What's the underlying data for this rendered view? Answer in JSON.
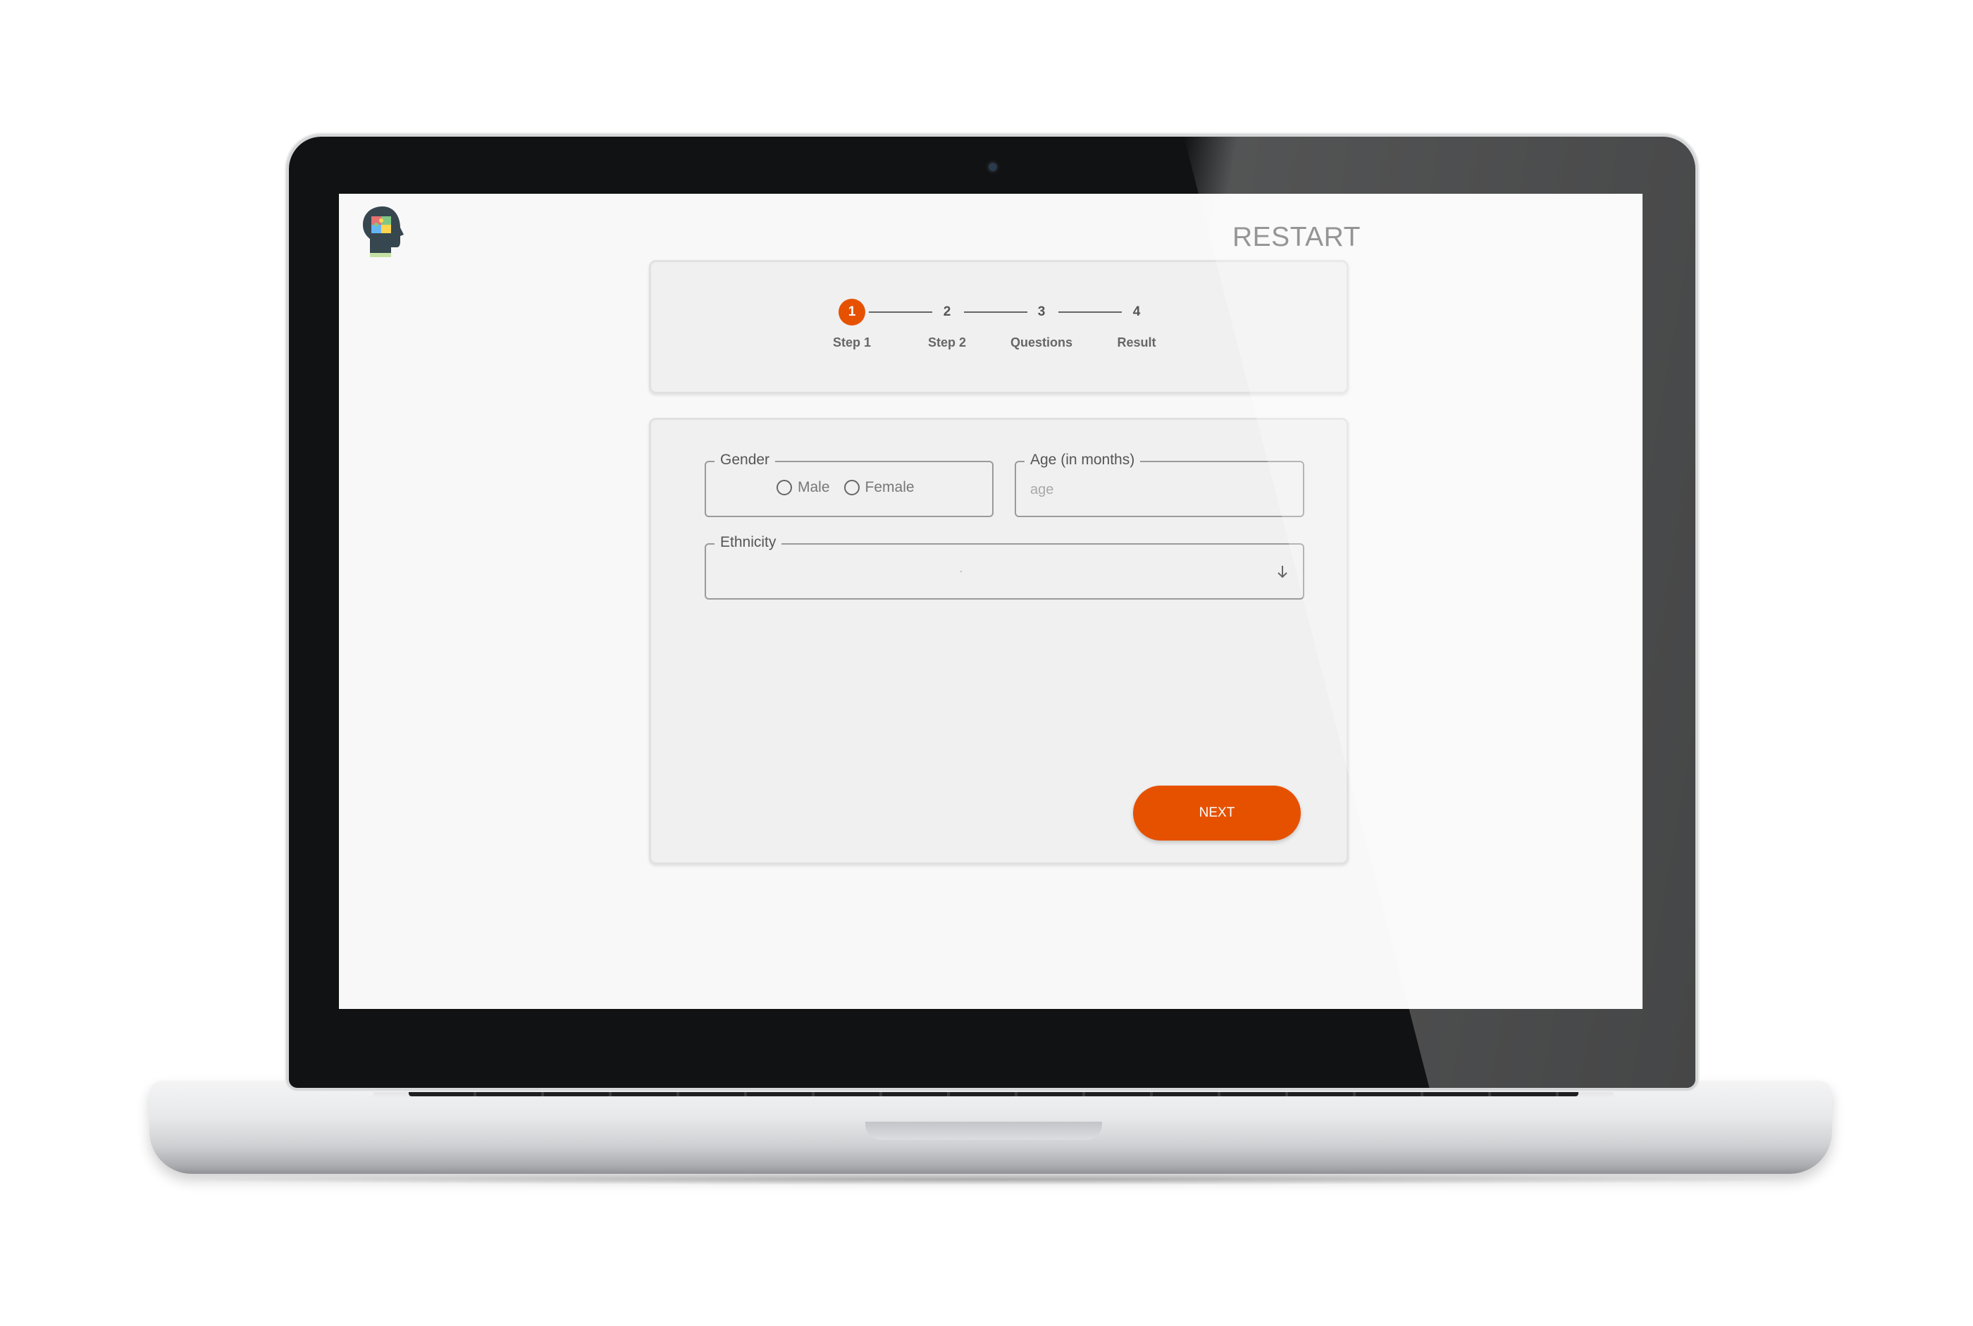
{
  "header": {
    "restart_label": "RESTART",
    "logo_icon": "head-puzzle-icon"
  },
  "stepper": {
    "active_index": 0,
    "accent_color": "#e65100",
    "steps": [
      {
        "number": "1",
        "label": "Step 1"
      },
      {
        "number": "2",
        "label": "Step 2"
      },
      {
        "number": "3",
        "label": "Questions"
      },
      {
        "number": "4",
        "label": "Result"
      }
    ]
  },
  "form": {
    "gender": {
      "legend": "Gender",
      "options": [
        "Male",
        "Female"
      ]
    },
    "age": {
      "legend": "Age (in months)",
      "placeholder": "age",
      "value": ""
    },
    "ethnicity": {
      "legend": "Ethnicity",
      "value": ".",
      "icon": "arrow-down-icon"
    },
    "next_label": "NEXT"
  }
}
